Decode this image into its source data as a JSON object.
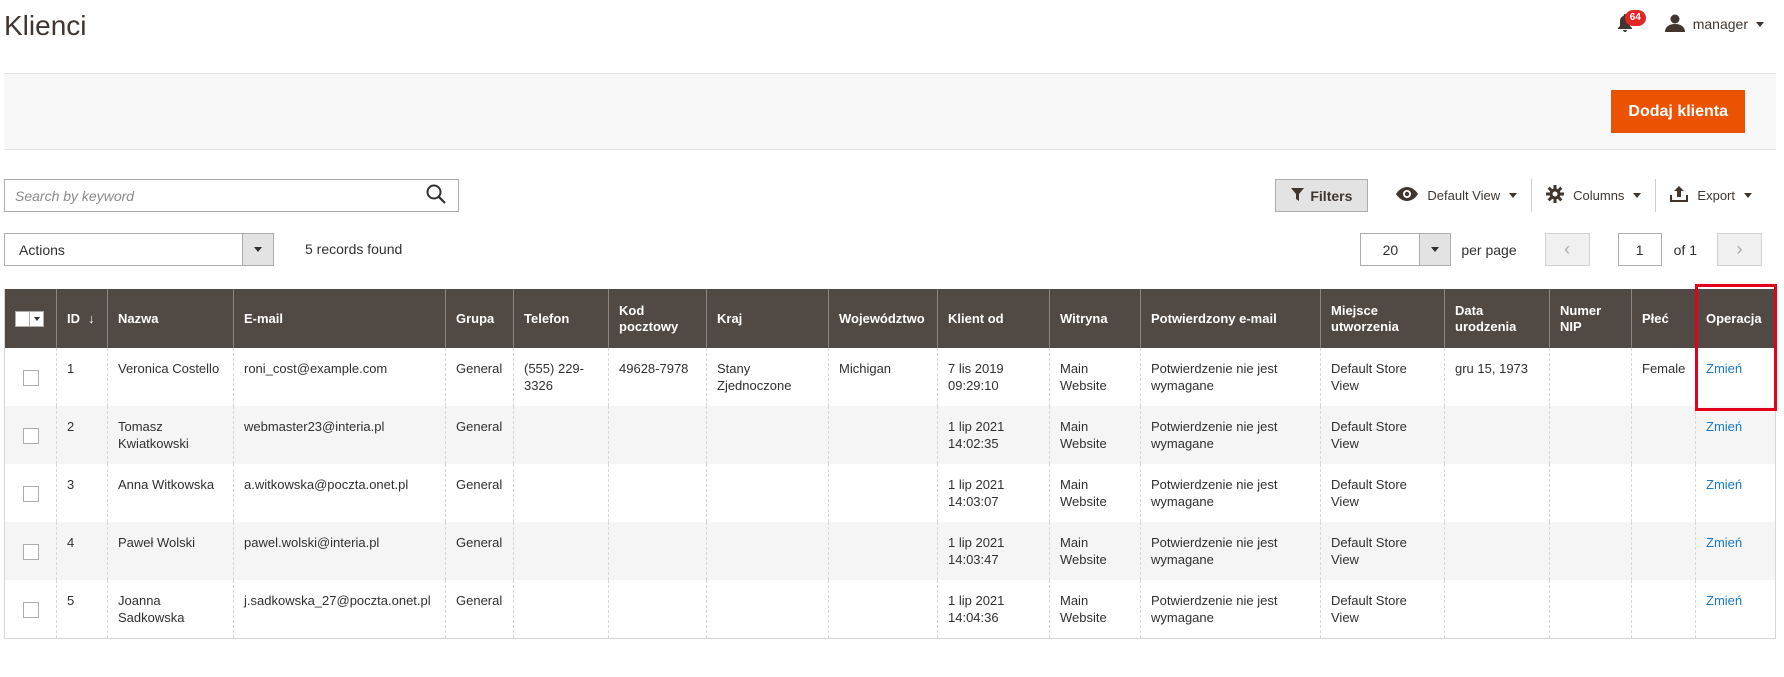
{
  "header": {
    "title": "Klienci",
    "notifications_count": "64",
    "user_name": "manager"
  },
  "action_bar": {
    "add_customer_label": "Dodaj klienta"
  },
  "search": {
    "placeholder": "Search by keyword",
    "value": ""
  },
  "toolbar": {
    "filters_label": "Filters",
    "view_label": "Default View",
    "columns_label": "Columns",
    "export_label": "Export"
  },
  "mass_actions": {
    "label": "Actions"
  },
  "records_found": "5 records found",
  "pager": {
    "per_page_value": "20",
    "per_page_label": "per page",
    "current_page": "1",
    "total_label": "of 1"
  },
  "grid": {
    "columns": {
      "id": "ID",
      "name": "Nazwa",
      "email": "E-mail",
      "group": "Grupa",
      "phone": "Telefon",
      "zip_line1": "Kod",
      "zip_line2": "pocztowy",
      "country": "Kraj",
      "region": "Województwo",
      "created": "Klient od",
      "website": "Witryna",
      "confirmed": "Potwierdzony e-mail",
      "created_in_line1": "Miejsce",
      "created_in_line2": "utworzenia",
      "dob_line1": "Data",
      "dob_line2": "urodzenia",
      "taxvat_line1": "Numer",
      "taxvat_line2": "NIP",
      "gender": "Płeć",
      "action": "Operacja"
    },
    "sort_indicator": "↓",
    "rows": [
      {
        "id": "1",
        "name": [
          "Veronica Costello",
          ""
        ],
        "email": "roni_cost@example.com",
        "group": "General",
        "phone": [
          "(555) 229-",
          "3326"
        ],
        "zip": "49628-7978",
        "country": [
          "Stany",
          "Zjednoczone"
        ],
        "region": "Michigan",
        "created": [
          "7 lis 2019",
          "09:29:10"
        ],
        "website": [
          "Main",
          "Website"
        ],
        "confirmed": [
          "Potwierdzenie nie jest",
          "wymagane"
        ],
        "created_in": [
          "Default Store",
          "View"
        ],
        "dob": "gru 15, 1973",
        "taxvat": "",
        "gender": "Female",
        "action": "Zmień"
      },
      {
        "id": "2",
        "name": [
          "Tomasz",
          "Kwiatkowski"
        ],
        "email": "webmaster23@interia.pl",
        "group": "General",
        "phone": [
          "",
          ""
        ],
        "zip": "",
        "country": [
          "",
          ""
        ],
        "region": "",
        "created": [
          "1 lip 2021",
          "14:02:35"
        ],
        "website": [
          "Main",
          "Website"
        ],
        "confirmed": [
          "Potwierdzenie nie jest",
          "wymagane"
        ],
        "created_in": [
          "Default Store",
          "View"
        ],
        "dob": "",
        "taxvat": "",
        "gender": "",
        "action": "Zmień"
      },
      {
        "id": "3",
        "name": [
          "Anna Witkowska",
          ""
        ],
        "email": "a.witkowska@poczta.onet.pl",
        "group": "General",
        "phone": [
          "",
          ""
        ],
        "zip": "",
        "country": [
          "",
          ""
        ],
        "region": "",
        "created": [
          "1 lip 2021",
          "14:03:07"
        ],
        "website": [
          "Main",
          "Website"
        ],
        "confirmed": [
          "Potwierdzenie nie jest",
          "wymagane"
        ],
        "created_in": [
          "Default Store",
          "View"
        ],
        "dob": "",
        "taxvat": "",
        "gender": "",
        "action": "Zmień"
      },
      {
        "id": "4",
        "name": [
          "Paweł Wolski",
          ""
        ],
        "email": "pawel.wolski@interia.pl",
        "group": "General",
        "phone": [
          "",
          ""
        ],
        "zip": "",
        "country": [
          "",
          ""
        ],
        "region": "",
        "created": [
          "1 lip 2021",
          "14:03:47"
        ],
        "website": [
          "Main",
          "Website"
        ],
        "confirmed": [
          "Potwierdzenie nie jest",
          "wymagane"
        ],
        "created_in": [
          "Default Store",
          "View"
        ],
        "dob": "",
        "taxvat": "",
        "gender": "",
        "action": "Zmień"
      },
      {
        "id": "5",
        "name": [
          "Joanna",
          "Sadkowska"
        ],
        "email": "j.sadkowska_27@poczta.onet.pl",
        "group": "General",
        "phone": [
          "",
          ""
        ],
        "zip": "",
        "country": [
          "",
          ""
        ],
        "region": "",
        "created": [
          "1 lip 2021",
          "14:04:36"
        ],
        "website": [
          "Main",
          "Website"
        ],
        "confirmed": [
          "Potwierdzenie nie jest",
          "wymagane"
        ],
        "created_in": [
          "Default Store",
          "View"
        ],
        "dob": "",
        "taxvat": "",
        "gender": "",
        "action": "Zmień"
      }
    ]
  },
  "colors": {
    "accent": "#eb5202",
    "header_bg": "#514943",
    "link": "#1979c3",
    "highlight": "#e2001a",
    "badge": "#e22626"
  },
  "icons": {
    "notifications": "bell-icon",
    "user": "user-icon",
    "search": "search-icon",
    "filter": "filter-icon",
    "view": "eye-icon",
    "columns": "gear-icon",
    "export": "export-icon"
  }
}
